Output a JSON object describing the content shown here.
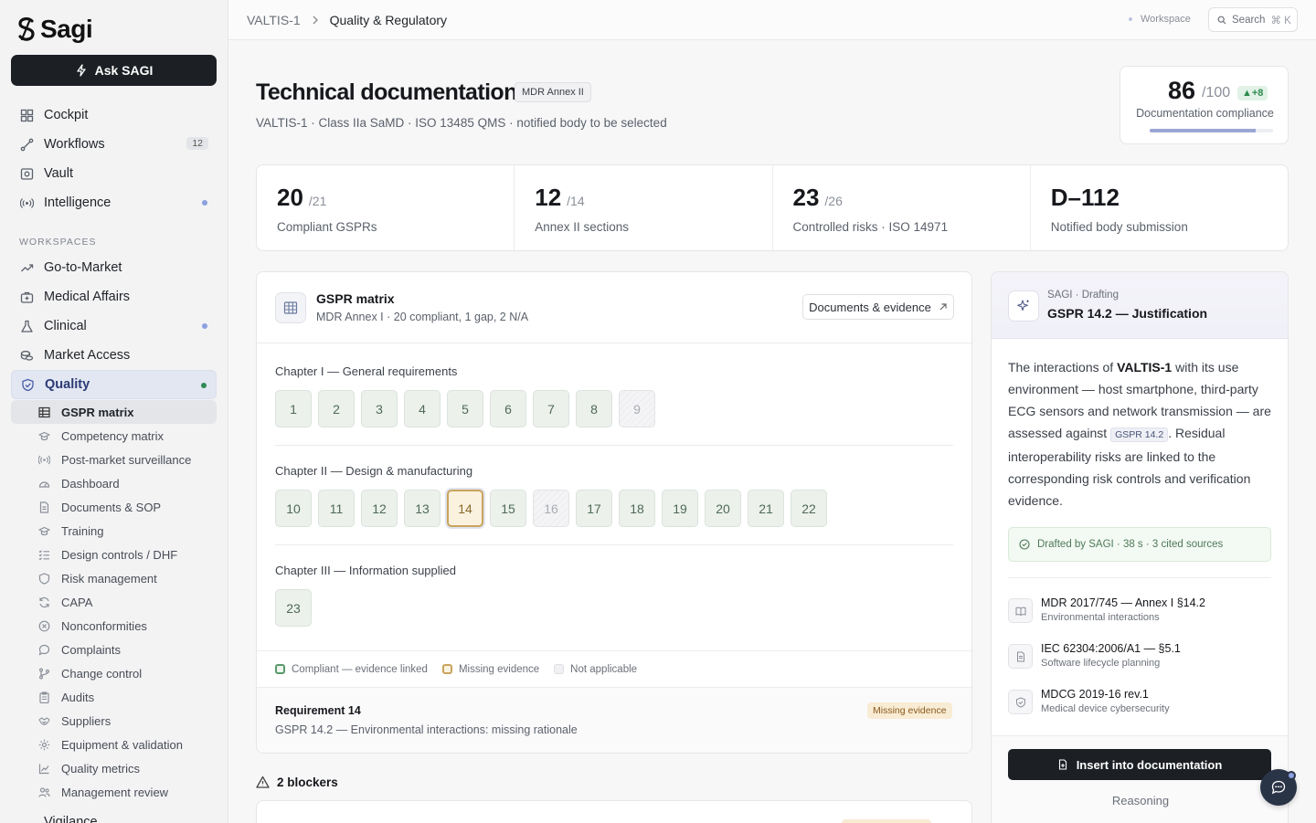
{
  "app": {
    "logo_text": "Sagi",
    "ask_label": "Ask SAGI"
  },
  "sidebar": {
    "main_items": [
      {
        "label": "Cockpit",
        "icon": "grid-icon"
      },
      {
        "label": "Workflows",
        "icon": "workflow-icon",
        "badge": "12"
      },
      {
        "label": "Vault",
        "icon": "vault-icon"
      },
      {
        "label": "Intelligence",
        "icon": "radar-icon",
        "dot": true
      }
    ],
    "workspaces_label": "WORKSPACES",
    "workspace_items": [
      {
        "label": "Go-to-Market",
        "icon": "trend-up-icon"
      },
      {
        "label": "Medical Affairs",
        "icon": "medical-case-icon"
      },
      {
        "label": "Clinical",
        "icon": "flask-icon",
        "dot": true
      },
      {
        "label": "Market Access",
        "icon": "coins-icon"
      },
      {
        "label": "Quality",
        "icon": "shield-check-icon",
        "dot": true,
        "active": true
      }
    ],
    "quality_sub_items": [
      {
        "label": "GSPR matrix",
        "icon": "table-icon",
        "active": true
      },
      {
        "label": "Competency matrix",
        "icon": "graduation-icon"
      },
      {
        "label": "Post-market surveillance",
        "icon": "radar-icon"
      },
      {
        "label": "Dashboard",
        "icon": "gauge-icon"
      },
      {
        "label": "Documents & SOP",
        "icon": "document-icon"
      },
      {
        "label": "Training",
        "icon": "graduation-icon"
      },
      {
        "label": "Design controls / DHF",
        "icon": "list-check-icon"
      },
      {
        "label": "Risk management",
        "icon": "shield-icon"
      },
      {
        "label": "CAPA",
        "icon": "refresh-icon"
      },
      {
        "label": "Nonconformities",
        "icon": "x-circle-icon"
      },
      {
        "label": "Complaints",
        "icon": "chat-icon"
      },
      {
        "label": "Change control",
        "icon": "branch-icon"
      },
      {
        "label": "Audits",
        "icon": "clipboard-icon"
      },
      {
        "label": "Suppliers",
        "icon": "handshake-icon"
      },
      {
        "label": "Equipment & validation",
        "icon": "gear-icon"
      },
      {
        "label": "Quality metrics",
        "icon": "chart-icon"
      },
      {
        "label": "Management review",
        "icon": "users-icon"
      }
    ],
    "cutoff_item": "Vigilance"
  },
  "topbar": {
    "breadcrumb": [
      "VALTIS-1",
      "Quality & Regulatory"
    ],
    "workspace_label": "Workspace",
    "search_label": "Search",
    "search_shortcut": "⌘ K"
  },
  "page": {
    "title": "Technical documentation",
    "tag": "MDR Annex II",
    "subtitle": "VALTIS-1 · Class IIa SaMD · ISO 13485 QMS · notified body to be selected"
  },
  "score": {
    "value": "86",
    "denominator": "/100",
    "delta": "▲+8",
    "label": "Documentation compliance",
    "progress_fraction": 0.86
  },
  "stats": [
    {
      "value": "20",
      "denominator": "/21",
      "label": "Compliant GSPRs"
    },
    {
      "value": "12",
      "denominator": "/14",
      "label": "Annex II sections"
    },
    {
      "value": "23",
      "denominator": "/26",
      "label": "Controlled risks · ISO 14971"
    },
    {
      "value": "D–112",
      "denominator": "",
      "label": "Notified body submission"
    }
  ],
  "matrix": {
    "title": "GSPR matrix",
    "subtitle": "MDR Annex I · 20 compliant, 1 gap, 2 N/A",
    "docs_button": "Documents & evidence",
    "chapters": [
      {
        "label": "Chapter I — General requirements",
        "cells": [
          {
            "n": "1",
            "s": "ok"
          },
          {
            "n": "2",
            "s": "ok"
          },
          {
            "n": "3",
            "s": "ok"
          },
          {
            "n": "4",
            "s": "ok"
          },
          {
            "n": "5",
            "s": "ok"
          },
          {
            "n": "6",
            "s": "ok"
          },
          {
            "n": "7",
            "s": "ok"
          },
          {
            "n": "8",
            "s": "ok"
          },
          {
            "n": "9",
            "s": "na"
          }
        ]
      },
      {
        "label": "Chapter II — Design & manufacturing",
        "cells": [
          {
            "n": "10",
            "s": "ok"
          },
          {
            "n": "11",
            "s": "ok"
          },
          {
            "n": "12",
            "s": "ok"
          },
          {
            "n": "13",
            "s": "ok"
          },
          {
            "n": "14",
            "s": "miss"
          },
          {
            "n": "15",
            "s": "ok"
          },
          {
            "n": "16",
            "s": "na"
          },
          {
            "n": "17",
            "s": "ok"
          },
          {
            "n": "18",
            "s": "ok"
          },
          {
            "n": "19",
            "s": "ok"
          },
          {
            "n": "20",
            "s": "ok"
          },
          {
            "n": "21",
            "s": "ok"
          },
          {
            "n": "22",
            "s": "ok"
          }
        ]
      },
      {
        "label": "Chapter III — Information supplied",
        "cells": [
          {
            "n": "23",
            "s": "ok"
          }
        ]
      }
    ],
    "legend": [
      "Compliant — evidence linked",
      "Missing evidence",
      "Not applicable"
    ],
    "requirement": {
      "title": "Requirement 14",
      "detail": "GSPR 14.2 — Environmental interactions: missing rationale",
      "badge": "Missing evidence"
    }
  },
  "blockers": {
    "label": "2 blockers"
  },
  "draft": {
    "kicker": "SAGI · Drafting",
    "title": "GSPR 14.2 — Justification",
    "body_1": "The interactions of ",
    "body_bold": "VALTIS-1",
    "body_2": " with its use environment — host smartphone, third-party ECG sensors and network transmission — are assessed against ",
    "body_chip": "GSPR 14.2",
    "body_3": ". Residual interoperability risks are linked to the corresponding risk controls and verification evidence.",
    "drafted_note": "Drafted by SAGI · 38 s · 3 cited sources",
    "sources": [
      {
        "title": "MDR 2017/745 — Annex I §14.2",
        "subtitle": "Environmental interactions",
        "icon": "book-icon"
      },
      {
        "title": "IEC 62304:2006/A1 — §5.1",
        "subtitle": "Software lifecycle planning",
        "icon": "document-icon"
      },
      {
        "title": "MDCG 2019-16 rev.1",
        "subtitle": "Medical device cybersecurity",
        "icon": "shield-icon"
      }
    ],
    "insert_label": "Insert into documentation",
    "reasoning_label": "Reasoning"
  }
}
